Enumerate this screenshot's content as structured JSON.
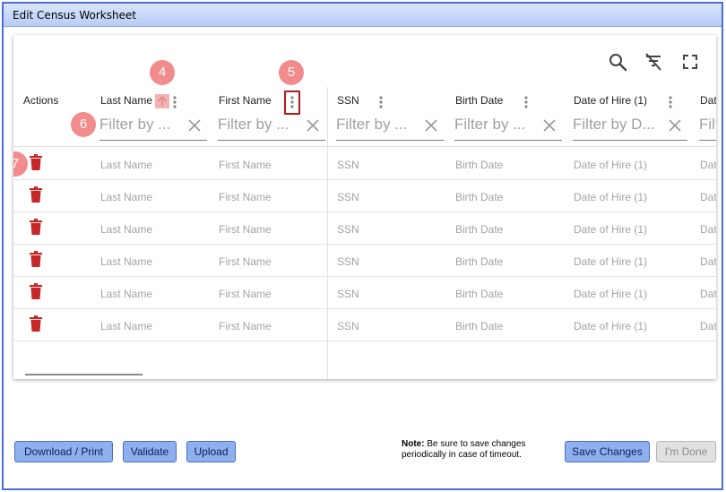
{
  "window": {
    "title": "Edit Census Worksheet"
  },
  "toolbar": {
    "icons": [
      "search-icon",
      "clear-filter-icon",
      "fullscreen-icon"
    ]
  },
  "grid": {
    "actions_header": "Actions",
    "columns": [
      {
        "key": "last_name",
        "header": "Last Name",
        "filter_placeholder": "Filter by ..."
      },
      {
        "key": "first_name",
        "header": "First Name",
        "filter_placeholder": "Filter by ..."
      },
      {
        "key": "ssn",
        "header": "SSN",
        "filter_placeholder": "Filter by ..."
      },
      {
        "key": "birth_date",
        "header": "Birth Date",
        "filter_placeholder": "Filter by ..."
      },
      {
        "key": "date_of_hire",
        "header": "Date of Hire (1)",
        "filter_placeholder": "Filter by D..."
      },
      {
        "key": "dat_cut",
        "header": "Dat",
        "filter_placeholder": "Filt"
      }
    ],
    "rows": [
      {
        "last_name": "Last Name",
        "first_name": "First Name",
        "ssn": "SSN",
        "birth_date": "Birth Date",
        "date_of_hire": "Date of Hire (1)",
        "dat_cut": "Dat"
      },
      {
        "last_name": "Last Name",
        "first_name": "First Name",
        "ssn": "SSN",
        "birth_date": "Birth Date",
        "date_of_hire": "Date of Hire (1)",
        "dat_cut": "Dat"
      },
      {
        "last_name": "Last Name",
        "first_name": "First Name",
        "ssn": "SSN",
        "birth_date": "Birth Date",
        "date_of_hire": "Date of Hire (1)",
        "dat_cut": "Dat"
      },
      {
        "last_name": "Last Name",
        "first_name": "First Name",
        "ssn": "SSN",
        "birth_date": "Birth Date",
        "date_of_hire": "Date of Hire (1)",
        "dat_cut": "Dat"
      },
      {
        "last_name": "Last Name",
        "first_name": "First Name",
        "ssn": "SSN",
        "birth_date": "Birth Date",
        "date_of_hire": "Date of Hire (1)",
        "dat_cut": "Dat"
      },
      {
        "last_name": "Last Name",
        "first_name": "First Name",
        "ssn": "SSN",
        "birth_date": "Birth Date",
        "date_of_hire": "Date of Hire (1)",
        "dat_cut": "Dat"
      }
    ]
  },
  "callouts": [
    "4",
    "5",
    "6",
    "7"
  ],
  "footer": {
    "download_print_label": "Download / Print",
    "validate_label": "Validate",
    "upload_label": "Upload",
    "note_label": "Note:",
    "note_text": "Be sure to save changes periodically in case of timeout.",
    "save_changes_label": "Save Changes",
    "im_done_label": "I'm Done"
  },
  "colors": {
    "accent": "#4a6fd8",
    "button_fill": "#8fb0ef",
    "callout": "#f28b8b",
    "delete_red": "#c62828"
  }
}
